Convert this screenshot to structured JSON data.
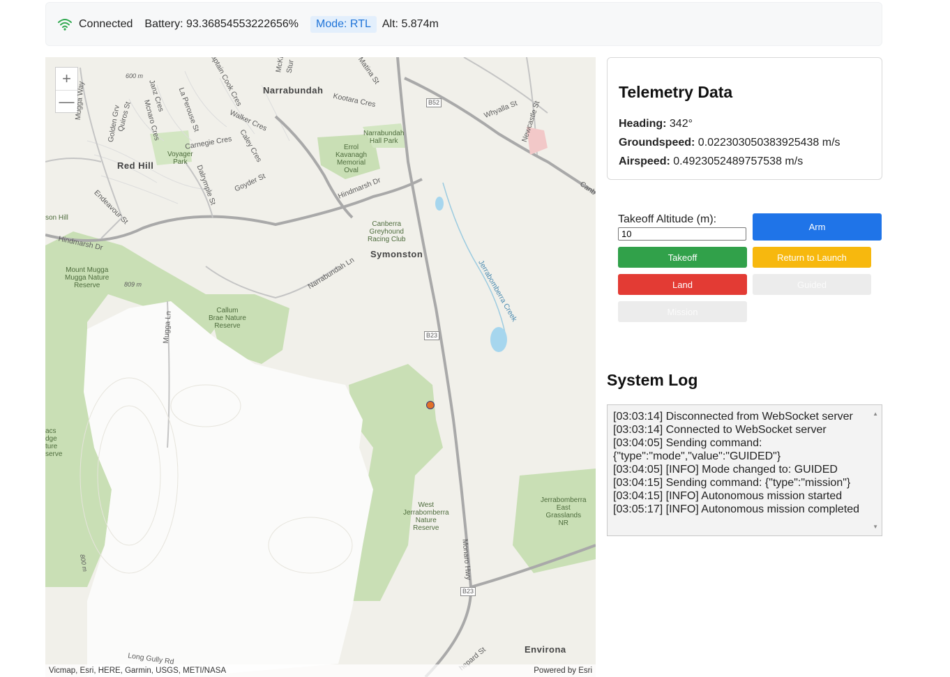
{
  "status": {
    "connection": "Connected",
    "battery": "Battery: 93.36854553222656%",
    "mode": "Mode: RTL",
    "alt": "Alt: 5.874m",
    "wifi_color": "#2fa84f"
  },
  "map": {
    "zoom_in": "+",
    "zoom_out": "—",
    "attribution_left": "Vicmap, Esri, HERE, Garmin, USGS, METI/NASA",
    "attribution_right": "Powered by Esri",
    "labels": {
      "narrabundah": "Narrabundah",
      "red_hill": "Red Hill",
      "symonston": "Symonston",
      "environa": "Environa",
      "hindmarsh_dr": "Hindmarsh Dr",
      "hindmarsh_dr_2": "Hindmarsh Dr",
      "mugga_way": "Mugga Way",
      "captain_cook": "Captain Cook Cres",
      "kootara": "Kootara Cres",
      "walker": "Walker Cres",
      "carnegie": "Carnegie Cres",
      "goyder": "Goyder St",
      "endeavour": "Endeavour St",
      "dalrymple": "Dalrymple St",
      "la_perouse": "La Perouse St",
      "monaro": "Monaro Hwy",
      "narrabundah_ln": "Narrabundah Ln",
      "mugga_ln": "Mugga Ln",
      "long_gully": "Long Gully Rd",
      "whyalla": "Whyalla St",
      "newcastle": "Newcastle St",
      "matina": "Matina St",
      "jerrabomberra_creek": "Jerrabomberra Creek",
      "errol": "Errol\nKavanagh\nMemorial\nOval",
      "narrabundah_hall": "Narrabundah\nHall Park",
      "voyager": "Voyager\nPark",
      "canberra_greyhound": "Canberra\nGreyhound\nRacing Club",
      "mount_mugga": "Mount Mugga\nMugga Nature\nReserve",
      "callum_brae": "Callum\nBrae Nature\nReserve",
      "west_jerrabomberra": "West\nJerrabomberra\nNature\nReserve",
      "jerrabomberra_east": "Jerrabomberra\nEast\nGrasslands\nNR",
      "son_hill": "son Hill",
      "macs": "acs\ndge\nture\nserve",
      "m600": "600 m",
      "m809": "809 m",
      "m800": "800 m",
      "b52": "B52",
      "b23a": "B23",
      "b23b": "B23",
      "golden_grv": "Golden Grv",
      "quiros": "Quiros St",
      "mcnaro": "Mcnaro Cres",
      "janz": "Janz Cres",
      "caley": "Caley Cres",
      "canb": "Canb",
      "mckinlay": "McKi",
      "sturt": "Stur",
      "shepard": "hepard St"
    }
  },
  "telemetry": {
    "title": "Telemetry Data",
    "heading_label": "Heading:",
    "heading_value": "342°",
    "groundspeed_label": "Groundspeed:",
    "groundspeed_value": "0.022303050383925438 m/s",
    "airspeed_label": "Airspeed:",
    "airspeed_value": "0.4923052489757538 m/s"
  },
  "controls": {
    "takeoff_altitude_label": "Takeoff Altitude (m):",
    "takeoff_altitude_value": "10",
    "arm": "Arm",
    "takeoff": "Takeoff",
    "return_to_launch": "Return to Launch",
    "land": "Land",
    "guided": "Guided",
    "mission": "Mission"
  },
  "log": {
    "title": "System Log",
    "lines": [
      "[03:03:14] Disconnected from WebSocket server",
      "[03:03:14] Connected to WebSocket server",
      "[03:04:05] Sending command: {\"type\":\"mode\",\"value\":\"GUIDED\"}",
      "[03:04:05] [INFO] Mode changed to: GUIDED",
      "[03:04:15] Sending command: {\"type\":\"mission\"}",
      "[03:04:15] [INFO] Autonomous mission started",
      "[03:05:17] [INFO] Autonomous mission completed"
    ]
  }
}
